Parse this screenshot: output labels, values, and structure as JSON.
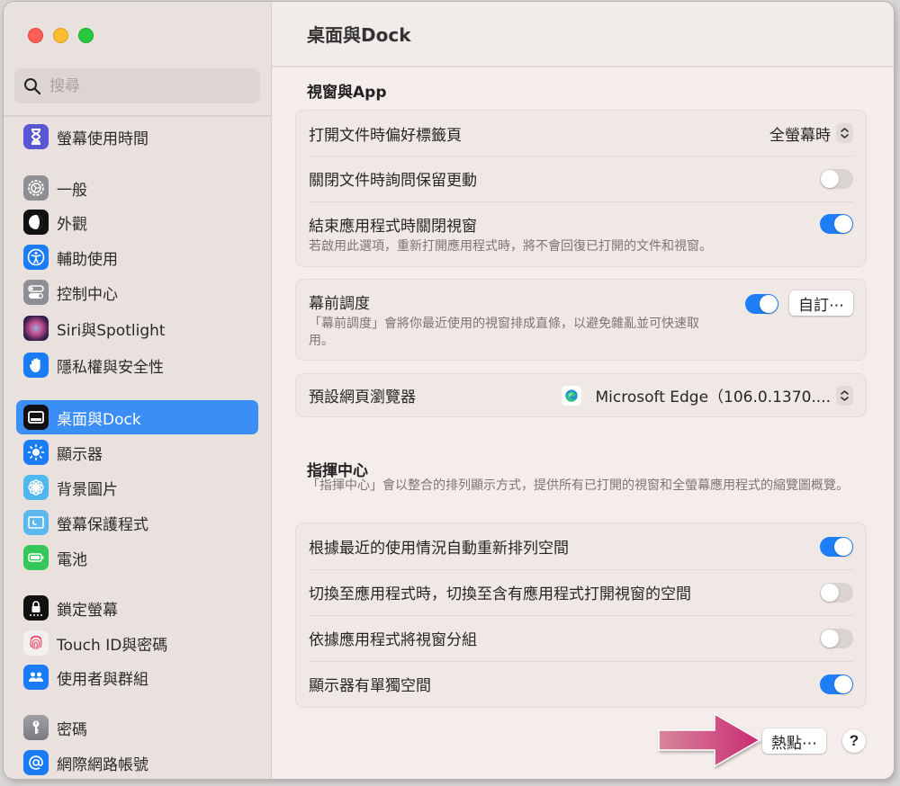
{
  "window": {
    "traffic_lights": [
      "close",
      "minimize",
      "zoom"
    ]
  },
  "sidebar": {
    "search": {
      "placeholder": "搜尋",
      "value": "",
      "icon": "search-icon"
    },
    "items": [
      {
        "label": "螢幕使用時間",
        "icon": "hourglass-icon",
        "color": "#5a56d6"
      },
      {
        "label": "一般",
        "icon": "gear-icon",
        "color": "#8e8e93"
      },
      {
        "label": "外觀",
        "icon": "appearance-icon",
        "color": "#111111"
      },
      {
        "label": "輔助使用",
        "icon": "accessibility-icon",
        "color": "#1b7cf3"
      },
      {
        "label": "控制中心",
        "icon": "control-center-icon",
        "color": "#8e8e93"
      },
      {
        "label": "Siri與Spotlight",
        "icon": "siri-icon",
        "color": "#2a1a3a"
      },
      {
        "label": "隱私權與安全性",
        "icon": "hand-icon",
        "color": "#1b7cf3"
      },
      {
        "label": "桌面與Dock",
        "icon": "desktop-dock-icon",
        "color": "#111111",
        "active": true
      },
      {
        "label": "顯示器",
        "icon": "sun-icon",
        "color": "#1b7cf3"
      },
      {
        "label": "背景圖片",
        "icon": "flower-icon",
        "color": "#4fb6ee"
      },
      {
        "label": "螢幕保護程式",
        "icon": "screensaver-icon",
        "color": "#5ab8ec"
      },
      {
        "label": "電池",
        "icon": "battery-icon",
        "color": "#35c759"
      },
      {
        "label": "鎖定螢幕",
        "icon": "lock-icon",
        "color": "#111111"
      },
      {
        "label": "Touch ID與密碼",
        "icon": "fingerprint-icon",
        "color": "#f4f0ef"
      },
      {
        "label": "使用者與群組",
        "icon": "users-icon",
        "color": "#1b7cf3"
      },
      {
        "label": "密碼",
        "icon": "key-icon",
        "color": "#8e8e93"
      },
      {
        "label": "網際網路帳號",
        "icon": "at-icon",
        "color": "#1b7cf3"
      }
    ]
  },
  "main": {
    "title": "桌面與Dock",
    "windows_apps": {
      "title": "視窗與App",
      "prefer_tabs": {
        "label": "打開文件時偏好標籤頁",
        "value": "全螢幕時"
      },
      "ask_keep_changes": {
        "label": "關閉文件時詢問保留更動",
        "on": false
      },
      "close_windows": {
        "label": "結束應用程式時關閉視窗",
        "desc": "若啟用此選項，重新打開應用程式時，將不會回復已打開的文件和視窗。",
        "on": true
      },
      "stage_manager": {
        "label": "幕前調度",
        "desc": "「幕前調度」會將你最近使用的視窗排成直條，以避免雜亂並可快速取用。",
        "on": true,
        "button": "自訂⋯"
      },
      "default_browser": {
        "label": "預設網頁瀏覽器",
        "value": "Microsoft Edge（106.0.1370...."
      }
    },
    "mission_control": {
      "title": "指揮中心",
      "desc": "「指揮中心」會以整合的排列顯示方式，提供所有已打開的視窗和全螢幕應用程式的縮覽圖概覽。",
      "rows": [
        {
          "label": "根據最近的使用情況自動重新排列空間",
          "on": true
        },
        {
          "label": "切換至應用程式時，切換至含有應用程式打開視窗的空間",
          "on": false
        },
        {
          "label": "依據應用程式將視窗分組",
          "on": false
        },
        {
          "label": "顯示器有單獨空間",
          "on": true
        }
      ]
    },
    "footer": {
      "hot_corners": "熱點⋯",
      "help": "?"
    },
    "annotation": {
      "arrow_color": "#d0357a"
    }
  }
}
